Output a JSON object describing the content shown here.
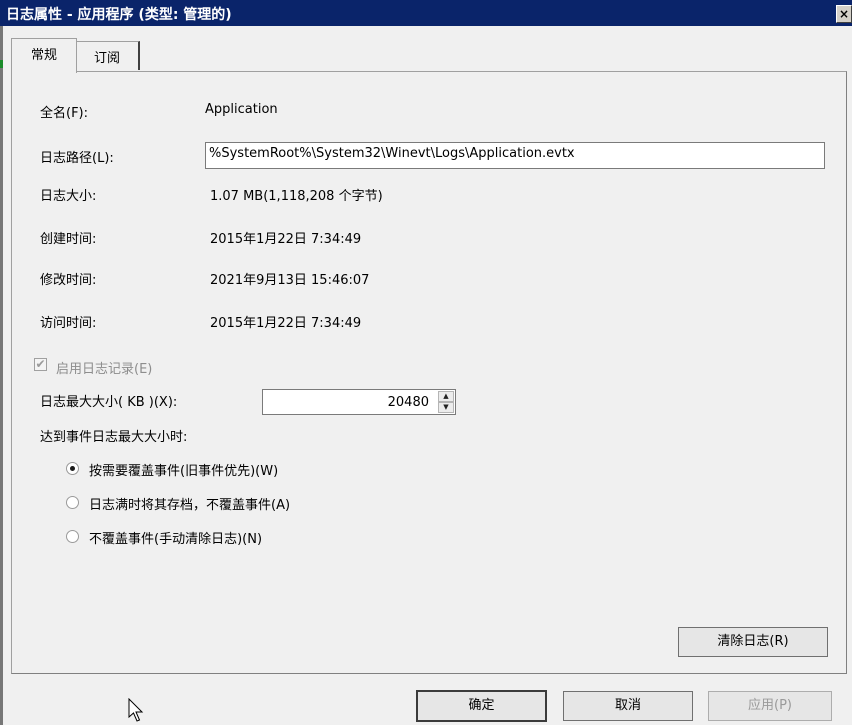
{
  "window": {
    "title": "日志属性 - 应用程序 (类型: 管理的)",
    "close_glyph": "×"
  },
  "tabs": [
    {
      "label": "常规",
      "active": true
    },
    {
      "label": "订阅",
      "active": false
    }
  ],
  "general": {
    "full_name_label": "全名(F):",
    "full_name_value": "Application",
    "log_path_label": "日志路径(L):",
    "log_path_value": "%SystemRoot%\\System32\\Winevt\\Logs\\Application.evtx",
    "log_size_label": "日志大小:",
    "log_size_value": "1.07 MB(1,118,208 个字节)",
    "created_label": "创建时间:",
    "created_value": "2015年1月22日 7:34:49",
    "modified_label": "修改时间:",
    "modified_value": "2021年9月13日 15:46:07",
    "accessed_label": "访问时间:",
    "accessed_value": "2015年1月22日 7:34:49",
    "enable_logging_label": "启用日志记录(E)",
    "enable_logging_checked": true,
    "max_size_label": "日志最大大小( KB )(X):",
    "max_size_value": "20480",
    "when_max_label": "达到事件日志最大大小时:",
    "options": [
      {
        "label": "按需要覆盖事件(旧事件优先)(W)",
        "checked": true
      },
      {
        "label": "日志满时将其存档，不覆盖事件(A)",
        "checked": false
      },
      {
        "label": "不覆盖事件(手动清除日志)(N)",
        "checked": false
      }
    ],
    "clear_log_label": "清除日志(R)"
  },
  "footer": {
    "ok_label": "确定",
    "cancel_label": "取消",
    "apply_label": "应用(P)"
  }
}
